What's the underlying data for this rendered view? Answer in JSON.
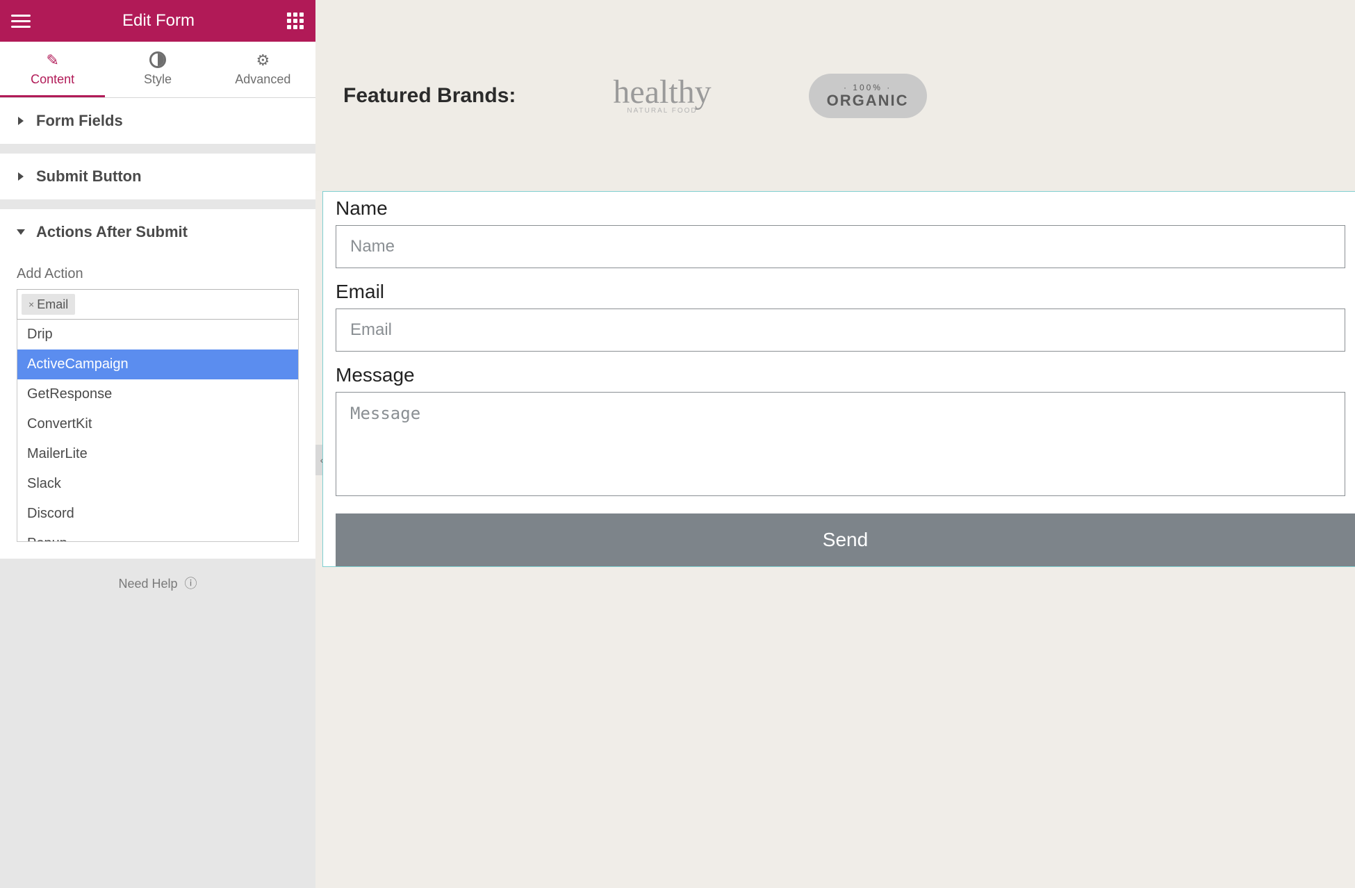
{
  "header": {
    "title": "Edit Form"
  },
  "editor_tabs": [
    {
      "key": "content",
      "label": "Content"
    },
    {
      "key": "style",
      "label": "Style"
    },
    {
      "key": "advanced",
      "label": "Advanced"
    }
  ],
  "sections": {
    "form_fields": {
      "label": "Form Fields"
    },
    "submit_button": {
      "label": "Submit Button"
    },
    "actions_after": {
      "label": "Actions After Submit"
    }
  },
  "add_action": {
    "label": "Add Action",
    "chip_remove": "×",
    "selected": [
      "Email"
    ],
    "options": [
      "Drip",
      "ActiveCampaign",
      "GetResponse",
      "ConvertKit",
      "MailerLite",
      "Slack",
      "Discord",
      "Popup"
    ],
    "highlighted": "ActiveCampaign"
  },
  "footer": {
    "need_help": "Need Help"
  },
  "collapse_glyph": "‹",
  "preview": {
    "brands_heading": "Featured Brands:",
    "brand1": {
      "name": "healthy",
      "tag": "NATURAL FOOD"
    },
    "brand2": {
      "top": "· 100% ·",
      "main": "ORGANIC"
    },
    "form": {
      "name": {
        "label": "Name",
        "placeholder": "Name"
      },
      "email": {
        "label": "Email",
        "placeholder": "Email"
      },
      "message": {
        "label": "Message",
        "placeholder": "Message"
      },
      "submit": "Send"
    }
  }
}
